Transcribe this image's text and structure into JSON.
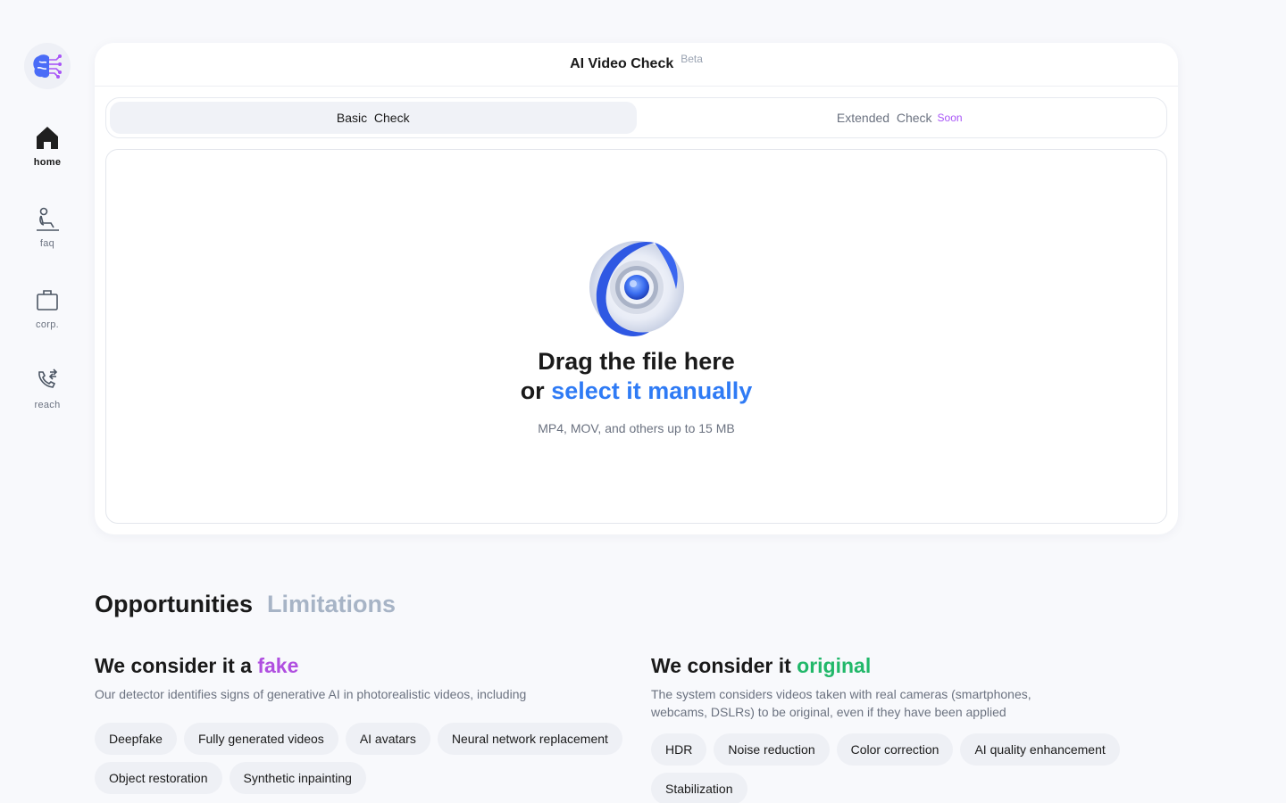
{
  "sidebar": {
    "items": [
      {
        "label": "home",
        "icon": "home-icon",
        "active": true
      },
      {
        "label": "faq",
        "icon": "faq-icon",
        "active": false
      },
      {
        "label": "corp.",
        "icon": "briefcase-icon",
        "active": false
      },
      {
        "label": "reach",
        "icon": "phone-icon",
        "active": false
      }
    ]
  },
  "card": {
    "title": "AI Video Check",
    "badge": "Beta",
    "tabs": [
      {
        "label": "Basic  Check",
        "active": true
      },
      {
        "label": "Extended  Check",
        "badge": "Soon",
        "active": false
      }
    ],
    "dropzone": {
      "line1": "Drag the file here",
      "line2_prefix": "or",
      "line2_link": "select it manually",
      "hint": "MP4, MOV, and others up to 15 MB"
    }
  },
  "section_tabs": [
    {
      "label": "Opportunities",
      "active": true
    },
    {
      "label": "Limitations",
      "active": false
    }
  ],
  "fake_col": {
    "heading_prefix": "We consider it a",
    "heading_accent": "fake",
    "desc": "Our detector identifies signs of generative AI in photorealistic videos, including",
    "chips": [
      "Deepfake",
      "Fully generated videos",
      "AI avatars",
      "Neural network replacement",
      "Object restoration",
      "Synthetic inpainting"
    ]
  },
  "original_col": {
    "heading_prefix": "We consider it",
    "heading_accent": "original",
    "desc": "The system considers videos taken with real cameras (smartphones, webcams, DSLRs) to be original, even if they have been applied",
    "chips": [
      "HDR",
      "Noise reduction",
      "Color correction",
      "AI quality enhancement",
      "Stabilization"
    ]
  },
  "colors": {
    "accent_blue": "#2f7bf5",
    "fake_purple": "#b04fe0",
    "original_green": "#22b86a",
    "soon_purple": "#a855f7"
  }
}
